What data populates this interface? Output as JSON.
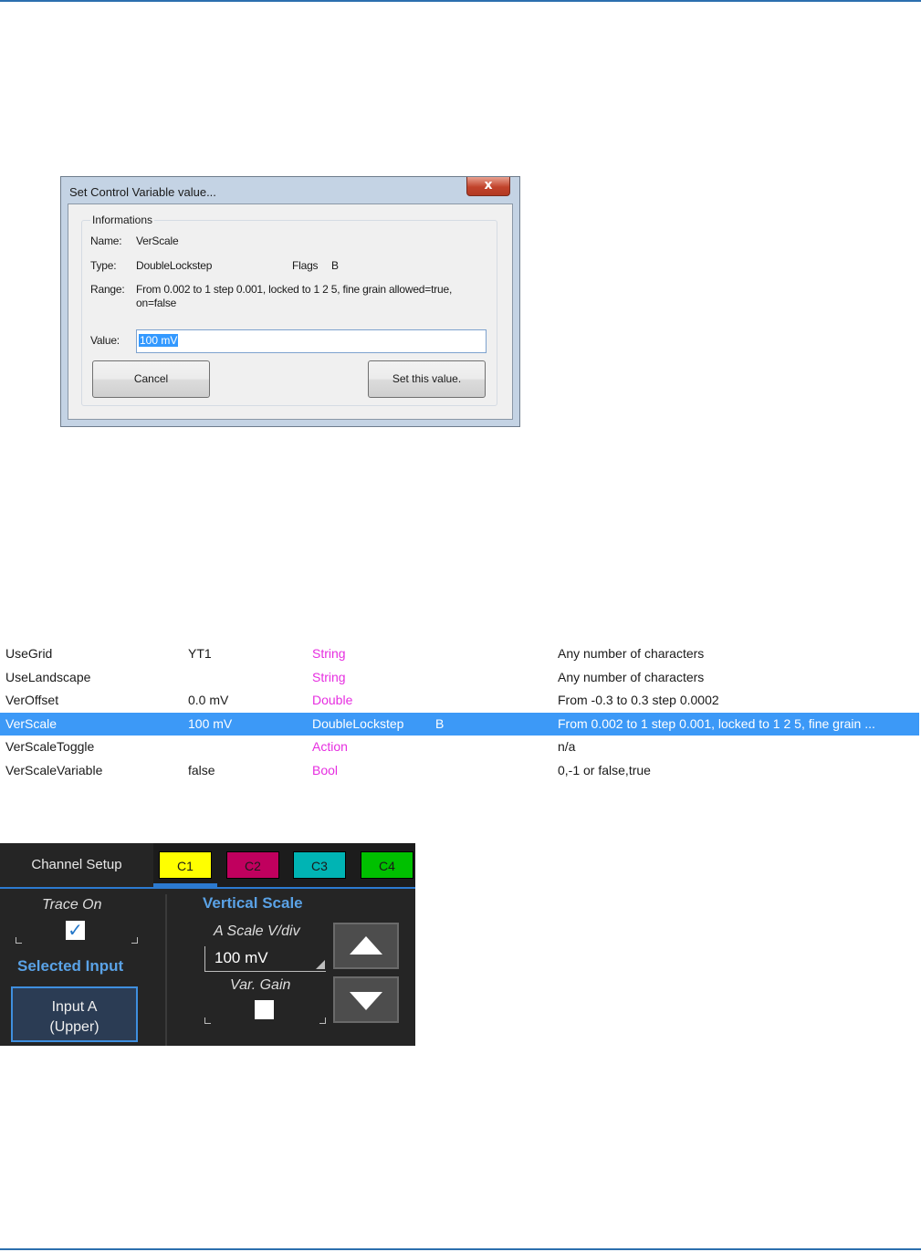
{
  "dialog": {
    "title": "Set Control Variable value...",
    "close_glyph": "x",
    "group_label": "Informations",
    "name_label": "Name:",
    "name_value": "VerScale",
    "type_label": "Type:",
    "type_value": "DoubleLockstep",
    "flags_label": "Flags",
    "flags_value": "B",
    "range_label": "Range:",
    "range_line1": "From 0.002 to 1 step 0.001, locked to 1 2 5, fine grain allowed=true,",
    "range_line2": "on=false",
    "value_label": "Value:",
    "value_input": "100 mV",
    "cancel_label": "Cancel",
    "set_label": "Set this value."
  },
  "table": {
    "rows": [
      {
        "name": "UseGrid",
        "value": "YT1",
        "type": "String",
        "flags": "",
        "range": "Any number of characters",
        "selected": false
      },
      {
        "name": "UseLandscape",
        "value": "",
        "type": "String",
        "flags": "",
        "range": "Any number of characters",
        "selected": false
      },
      {
        "name": "VerOffset",
        "value": "0.0 mV",
        "type": "Double",
        "flags": "",
        "range": "From -0.3 to 0.3 step 0.0002",
        "selected": false
      },
      {
        "name": "VerScale",
        "value": "100 mV",
        "type": "DoubleLockstep",
        "flags": "B",
        "range": "From 0.002 to 1 step 0.001, locked to 1 2 5, fine grain ...",
        "selected": true
      },
      {
        "name": "VerScaleToggle",
        "value": "",
        "type": "Action",
        "flags": "",
        "range": "n/a",
        "selected": false
      },
      {
        "name": "VerScaleVariable",
        "value": "false",
        "type": "Bool",
        "flags": "",
        "range": "0,-1 or false,true",
        "selected": false
      }
    ]
  },
  "panel": {
    "tab_label": "Channel Setup",
    "channels": [
      {
        "label": "C1",
        "color": "#ffff00",
        "text_color": "#1a1a1a"
      },
      {
        "label": "C2",
        "color": "#c0005e",
        "text_color": "#1a1a1a"
      },
      {
        "label": "C3",
        "color": "#00b4b4",
        "text_color": "#1a1a1a"
      },
      {
        "label": "C4",
        "color": "#00c000",
        "text_color": "#1a1a1a"
      }
    ],
    "trace_on_label": "Trace On",
    "trace_on_checked": true,
    "selected_input_label": "Selected Input",
    "input_button_line1": "Input A",
    "input_button_line2": "(Upper)",
    "vertical_scale_label": "Vertical Scale",
    "scale_label": "A Scale V/div",
    "scale_value": "100 mV",
    "var_gain_label": "Var. Gain",
    "var_gain_checked": false,
    "check_glyph": "✓",
    "up_icon": "triangle-up-icon",
    "down_icon": "triangle-down-icon"
  }
}
